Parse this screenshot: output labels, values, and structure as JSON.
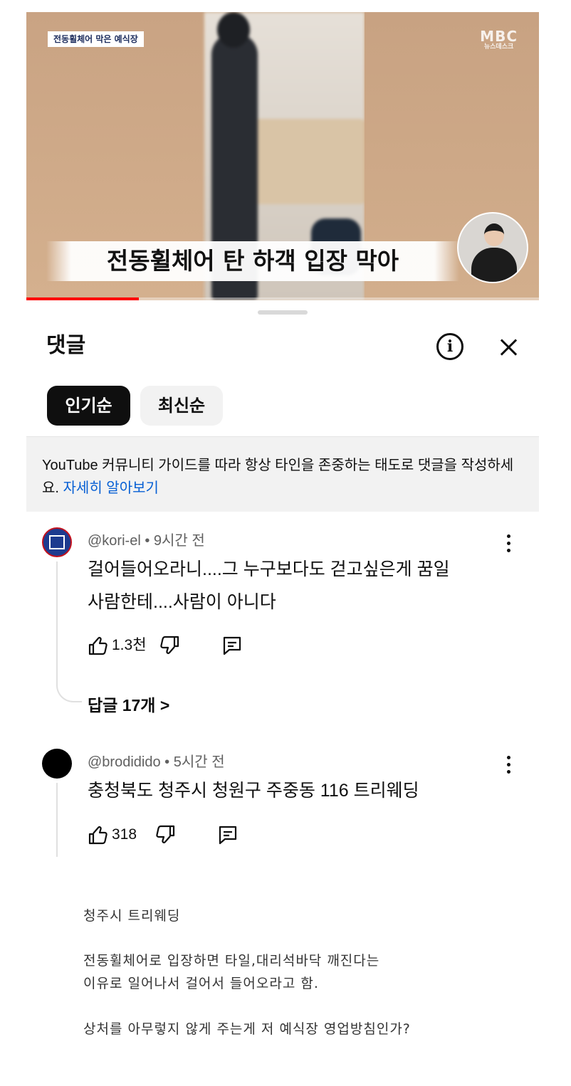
{
  "video": {
    "badge": "전동휠체어 막은 예식장",
    "logo_big": "MBC",
    "logo_small": "뉴스데스크",
    "caption": "전동휠체어 탄 하객 입장 막아",
    "progress_fraction": 0.22,
    "colors": {
      "progress": "#ff0000"
    }
  },
  "panel": {
    "title": "댓글",
    "info_icon": "info-icon",
    "close_icon": "close-icon",
    "chips": [
      "인기순",
      "최신순"
    ],
    "guide_text": "YouTube 커뮤니티 가이드를 따라 항상 타인을 존중하는 태도로 댓글을 작성하세요.",
    "guide_link": "자세히 알아보기"
  },
  "comments": [
    {
      "author": "@kori-el",
      "time": "9시간 전",
      "text_line1": "걸어들어오라니....그 누구보다도 걷고싶은게 꿈일",
      "text_line2": "사람한테....사람이 아니다",
      "likes": "1.3천",
      "replies": "답글 17개 >"
    },
    {
      "author": "@brodidido",
      "time": "5시간 전",
      "text_line1": "충청북도 청주시 청원구 주중동 116 트리웨딩",
      "likes": "318"
    }
  ],
  "post": {
    "p1": "청주시 트리웨딩",
    "p2_line1": "전동휠체어로 입장하면 타일,대리석바닥 깨진다는",
    "p2_line2": "이유로 일어나서 걸어서 들어오라고 함.",
    "p3": "상처를 아무렇지 않게 주는게 저 예식장 영업방침인가?"
  }
}
